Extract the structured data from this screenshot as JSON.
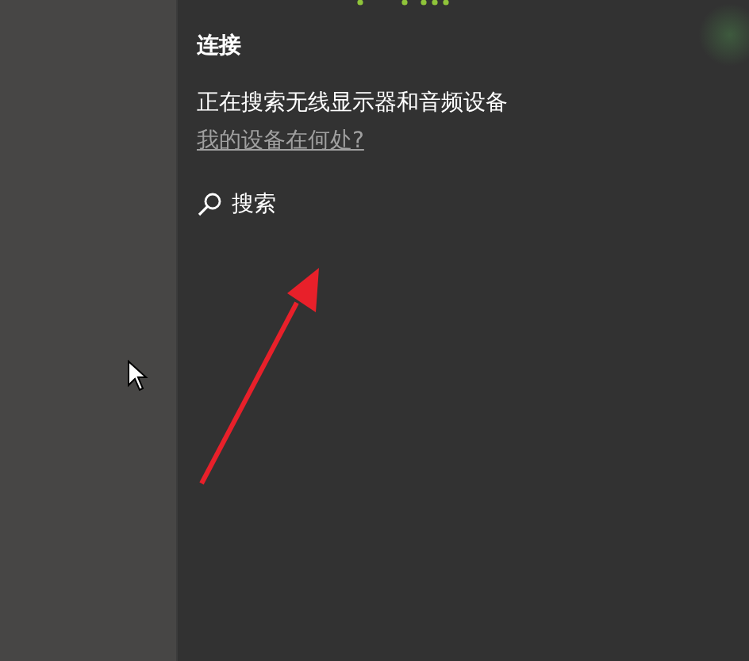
{
  "panel": {
    "title": "连接",
    "status": "正在搜索无线显示器和音频设备",
    "help_link": "我的设备在何处?",
    "search_button": "搜索"
  }
}
